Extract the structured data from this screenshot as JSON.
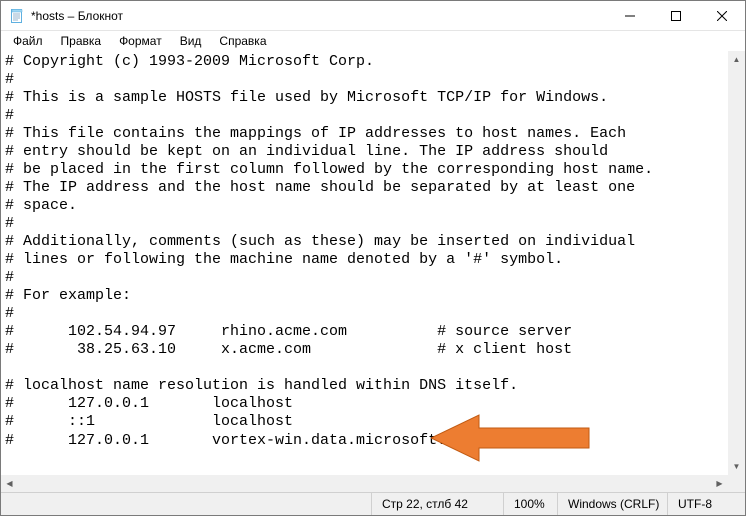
{
  "titlebar": {
    "title": "*hosts – Блокнот"
  },
  "menubar": {
    "items": [
      {
        "label": "Файл"
      },
      {
        "label": "Правка"
      },
      {
        "label": "Формат"
      },
      {
        "label": "Вид"
      },
      {
        "label": "Справка"
      }
    ]
  },
  "editor": {
    "lines": [
      "# Copyright (c) 1993-2009 Microsoft Corp.",
      "#",
      "# This is a sample HOSTS file used by Microsoft TCP/IP for Windows.",
      "#",
      "# This file contains the mappings of IP addresses to host names. Each",
      "# entry should be kept on an individual line. The IP address should",
      "# be placed in the first column followed by the corresponding host name.",
      "# The IP address and the host name should be separated by at least one",
      "# space.",
      "#",
      "# Additionally, comments (such as these) may be inserted on individual",
      "# lines or following the machine name denoted by a '#' symbol.",
      "#",
      "# For example:",
      "#",
      "#      102.54.94.97     rhino.acme.com          # source server",
      "#       38.25.63.10     x.acme.com              # x client host",
      "",
      "# localhost name resolution is handled within DNS itself.",
      "#      127.0.0.1       localhost",
      "#      ::1             localhost",
      "#      127.0.0.1       vortex-win.data.microsoft.com"
    ]
  },
  "statusbar": {
    "position": "Стр 22, стлб 42",
    "zoom": "100%",
    "eol": "Windows (CRLF)",
    "encoding": "UTF-8"
  },
  "icons": {
    "notepad": "notepad-icon",
    "minimize": "minimize-icon",
    "maximize": "maximize-icon",
    "close": "close-icon"
  }
}
